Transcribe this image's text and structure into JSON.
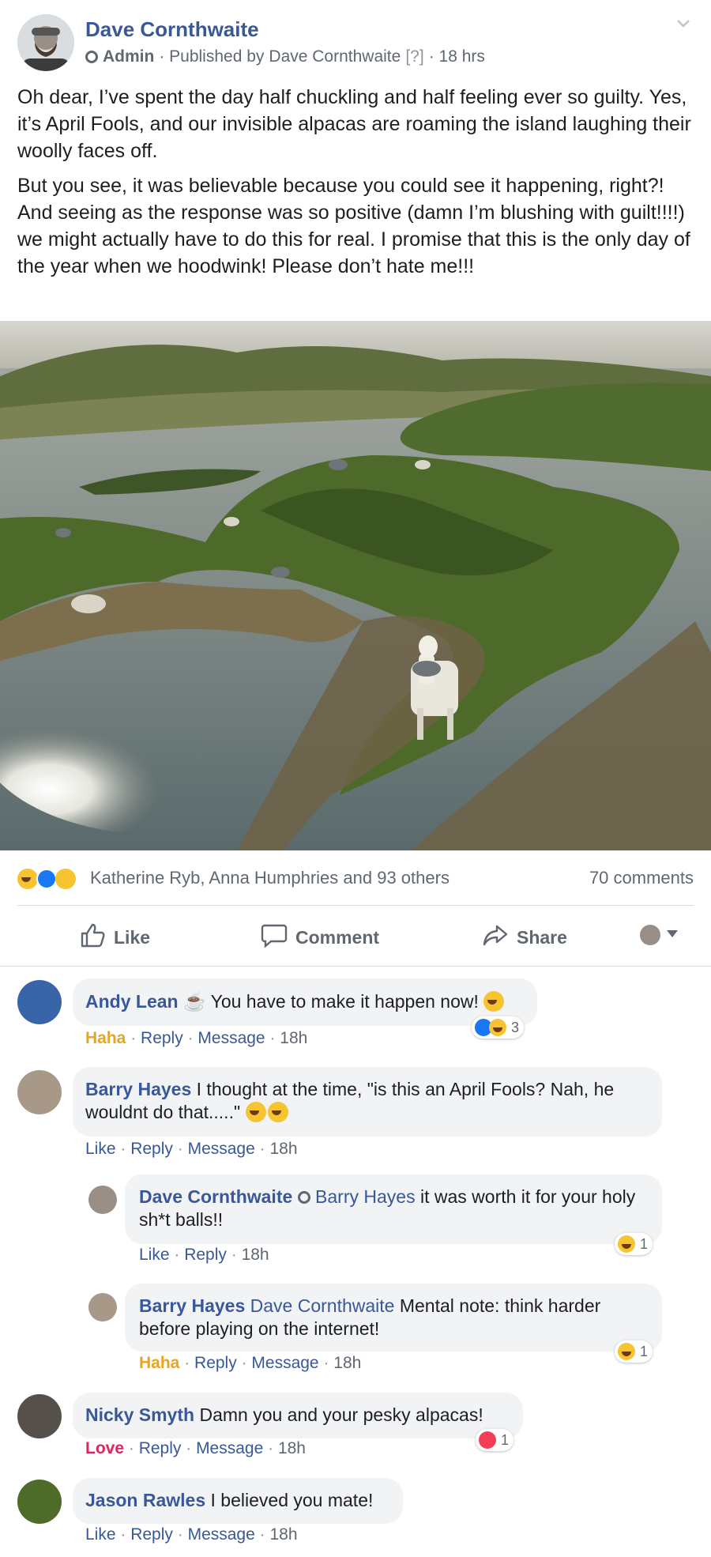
{
  "post": {
    "author": "Dave Cornthwaite",
    "role": "Admin",
    "published_prefix": "· Published by",
    "published_by": "Dave Cornthwaite",
    "help_marker": "[?]",
    "time": "· 18 hrs",
    "paragraph1": "Oh dear, I’ve spent the day half chuckling and half feeling ever so guilty. Yes, it’s April Fools, and our invisible alpacas are roaming the island laughing their woolly faces off.",
    "paragraph2": "But you see, it was believable because you could see it happening, right?! And seeing as the response was so positive (damn I’m blushing with guilt!!!!) we might actually have to do this for real. I promise that this is the only day of the year when we hoodwink! Please don’t hate me!!!"
  },
  "reactions": {
    "summary": "Katherine Ryb, Anna Humphries and 93 others",
    "comments": "70 comments"
  },
  "action_bar": {
    "like": "Like",
    "comment": "Comment",
    "share": "Share"
  },
  "comments": [
    {
      "author": "Andy Lean",
      "text": "You have to make it happen now!",
      "reaction_label": "Haha",
      "reply": "Reply",
      "message": "Message",
      "time": "18h",
      "reaction_count": "3"
    },
    {
      "author": "Barry Hayes",
      "text": "I thought at the time, \"is this an April Fools? Nah, he wouldnt do that.....\"",
      "reaction_label": "Like",
      "reply": "Reply",
      "message": "Message",
      "time": "18h"
    },
    {
      "author": "Nicky Smyth",
      "text": "Damn you and your pesky alpacas!",
      "reaction_label": "Love",
      "reply": "Reply",
      "message": "Message",
      "time": "18h",
      "reaction_count": "1"
    },
    {
      "author": "Jason Rawles",
      "text": "I believed you mate!",
      "reaction_label": "Like",
      "reply": "Reply",
      "message": "Message",
      "time": "18h"
    }
  ],
  "replies": [
    {
      "author": "Dave Cornthwaite",
      "tag": "Barry Hayes",
      "text": "it was worth it for your holy sh*t balls!!",
      "reaction_label": "Like",
      "reply": "Reply",
      "time": "18h",
      "reaction_count": "1"
    },
    {
      "author": "Barry Hayes",
      "tag": "Dave Cornthwaite",
      "text": "Mental note: think harder before playing on the internet!",
      "reaction_label": "Haha",
      "reply": "Reply",
      "message": "Message",
      "time": "18h",
      "reaction_count": "1"
    }
  ],
  "colors": {
    "link": "#385898",
    "haha": "#e8a524",
    "love": "#e0245e",
    "bubble": "#f2f3f5"
  }
}
